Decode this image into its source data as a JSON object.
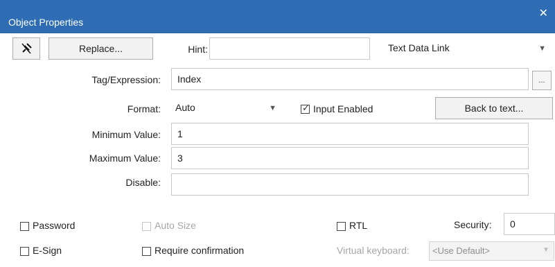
{
  "window": {
    "title": "Object Properties",
    "close_glyph": "✕"
  },
  "toolbar": {
    "pin_icon": "pin-icon",
    "replace_label": "Replace...",
    "hint_label": "Hint:",
    "hint_value": "",
    "link_type": "Text Data Link"
  },
  "fields": {
    "tag": {
      "label": "Tag/Expression:",
      "value": "Index",
      "browse_label": "..."
    },
    "format": {
      "label": "Format:",
      "value": "Auto"
    },
    "input_enabled": {
      "label": "Input Enabled",
      "checked": true
    },
    "back_to_text_label": "Back to text...",
    "min": {
      "label": "Minimum Value:",
      "value": "1"
    },
    "max": {
      "label": "Maximum Value:",
      "value": "3"
    },
    "disable": {
      "label": "Disable:",
      "value": ""
    }
  },
  "options": {
    "password_label": "Password",
    "autosize_label": "Auto Size",
    "rtl_label": "RTL",
    "security_label": "Security:",
    "security_value": "0",
    "esign_label": "E-Sign",
    "require_confirmation_label": "Require confirmation",
    "virtual_keyboard_label": "Virtual keyboard:",
    "virtual_keyboard_value": "<Use Default>"
  },
  "colors": {
    "title_bar": "#2e6db4",
    "title_text": "#ffffff",
    "disabled_text": "#a6a6a6"
  }
}
